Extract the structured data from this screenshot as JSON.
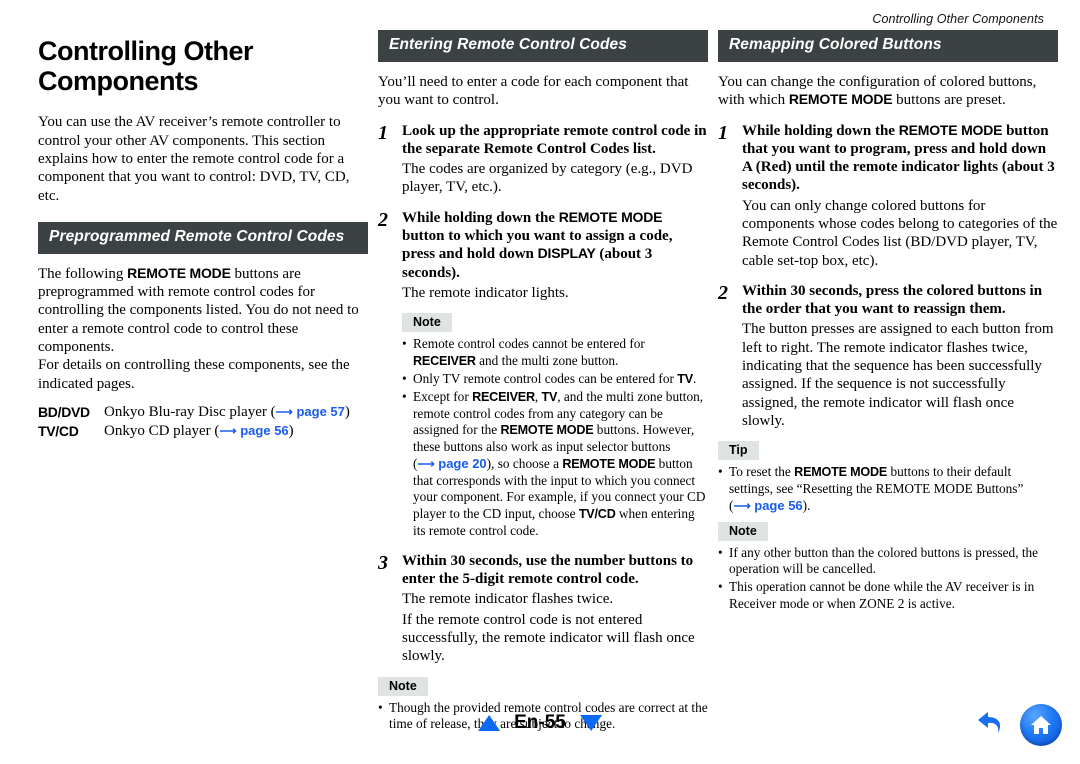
{
  "running_header": "Controlling Other Components",
  "chapter": {
    "title": "Controlling Other Components",
    "intro": "You can use the AV receiver’s remote controller to control your other AV components. This section explains how to enter the remote control code for a component that you want to control: DVD, TV, CD, etc."
  },
  "section_preprogrammed": {
    "heading": "Preprogrammed Remote Control Codes",
    "para1_pre": "The following ",
    "para1_bold": "REMOTE MODE",
    "para1_post": " buttons are preprogrammed with remote control codes for controlling the components listed. You do not need to enter a remote control code to control these components.",
    "para2": "For details on controlling these components, see the indicated pages.",
    "rows": [
      {
        "key": "BD/DVD",
        "value": "Onkyo Blu-ray Disc player",
        "page": "page 57"
      },
      {
        "key": "TV/CD",
        "value": "Onkyo CD player",
        "page": "page 56"
      }
    ]
  },
  "section_entering": {
    "heading": "Entering Remote Control Codes",
    "intro": "You’ll need to enter a code for each component that you want to control.",
    "steps": [
      {
        "num": "1",
        "head": "Look up the appropriate remote control code in the separate Remote Control Codes list.",
        "sub": "The codes are organized by category (e.g., DVD player, TV, etc.)."
      },
      {
        "num": "2",
        "head_a": "While holding down the ",
        "head_b": "REMOTE MODE",
        "head_c": " button to which you want to assign a code, press and hold down ",
        "head_d": "DISPLAY",
        "head_e": " (about 3 seconds).",
        "sub": "The remote indicator lights."
      },
      {
        "num": "3",
        "head": "Within 30 seconds, use the number buttons to enter the 5-digit remote control code.",
        "sub1": "The remote indicator flashes twice.",
        "sub2": "If the remote control code is not entered successfully, the remote indicator will flash once slowly."
      }
    ],
    "note1_label": "Note",
    "note1_bullets": [
      {
        "parts": [
          {
            "t": "Remote control codes cannot be entered for ",
            "b": false
          },
          {
            "t": "RECEIVER",
            "b": true
          },
          {
            "t": " and the multi zone button.",
            "b": false
          }
        ]
      },
      {
        "parts": [
          {
            "t": "Only TV remote control codes can be entered for ",
            "b": false
          },
          {
            "t": "TV",
            "b": true
          },
          {
            "t": ".",
            "b": false
          }
        ]
      },
      {
        "parts": [
          {
            "t": "Except for ",
            "b": false
          },
          {
            "t": "RECEIVER",
            "b": true
          },
          {
            "t": ", ",
            "b": false
          },
          {
            "t": "TV",
            "b": true
          },
          {
            "t": ", and the multi zone button, remote control codes from any category can be assigned for the ",
            "b": false
          },
          {
            "t": "REMOTE MODE",
            "b": true
          },
          {
            "t": " buttons. However, these buttons also work as input selector buttons (",
            "b": false
          },
          {
            "t": "→ page 20",
            "b": false,
            "link": true
          },
          {
            "t": "), so choose a ",
            "b": false
          },
          {
            "t": "REMOTE MODE",
            "b": true
          },
          {
            "t": " button that corresponds with the input to which you connect your component. For example, if you connect your CD player to the CD input, choose ",
            "b": false
          },
          {
            "t": "TV/CD",
            "b": true
          },
          {
            "t": " when entering its remote control code.",
            "b": false
          }
        ]
      }
    ],
    "note2_label": "Note",
    "note2_bullets": [
      {
        "parts": [
          {
            "t": "Though the provided remote control codes are correct at the time of release, they are subject to change.",
            "b": false
          }
        ]
      }
    ]
  },
  "section_remapping": {
    "heading": "Remapping Colored Buttons",
    "intro_a": "You can change the configuration of colored buttons, with which ",
    "intro_b": "REMOTE MODE",
    "intro_c": " buttons are preset.",
    "steps": [
      {
        "num": "1",
        "head_a": "While holding down the ",
        "head_b": "REMOTE MODE",
        "head_c": " button that you want to program, press and hold down A (Red) until the remote indicator lights (about 3 seconds).",
        "sub": "You can only change colored buttons for components whose codes belong to categories of the Remote Control Codes list (BD/DVD player, TV, cable set-top box, etc)."
      },
      {
        "num": "2",
        "head": "Within 30 seconds, press the colored buttons in the order that you want to reassign them.",
        "sub": "The button presses are assigned to each button from left to right. The remote indicator flashes twice, indicating that the sequence has been successfully assigned. If the sequence is not successfully assigned, the remote indicator will flash once slowly."
      }
    ],
    "tip_label": "Tip",
    "tip_bullets": [
      {
        "parts": [
          {
            "t": "To reset the ",
            "b": false
          },
          {
            "t": "REMOTE MODE",
            "b": true
          },
          {
            "t": " buttons to their default settings, see “Resetting the REMOTE MODE Buttons” (",
            "b": false
          },
          {
            "t": "→ page 56",
            "b": false,
            "link": true
          },
          {
            "t": ").",
            "b": false
          }
        ]
      }
    ],
    "note_label": "Note",
    "note_bullets": [
      {
        "parts": [
          {
            "t": "If any other button than the colored buttons is pressed, the operation will be cancelled.",
            "b": false
          }
        ]
      },
      {
        "parts": [
          {
            "t": "This operation cannot be done while the AV receiver is in Receiver mode or when ZONE 2 is active.",
            "b": false
          }
        ]
      }
    ]
  },
  "footer": {
    "page_label": "En-55",
    "prev_icon": "triangle-up-icon",
    "next_icon": "triangle-down-icon",
    "back_icon": "back-arrow-icon",
    "home_icon": "home-icon"
  },
  "colors": {
    "section_bar_bg": "#3c4244",
    "badge_bg": "#dfe4e0",
    "link_blue": "#1a5cf0",
    "nav_blue": "#0b69f5"
  }
}
